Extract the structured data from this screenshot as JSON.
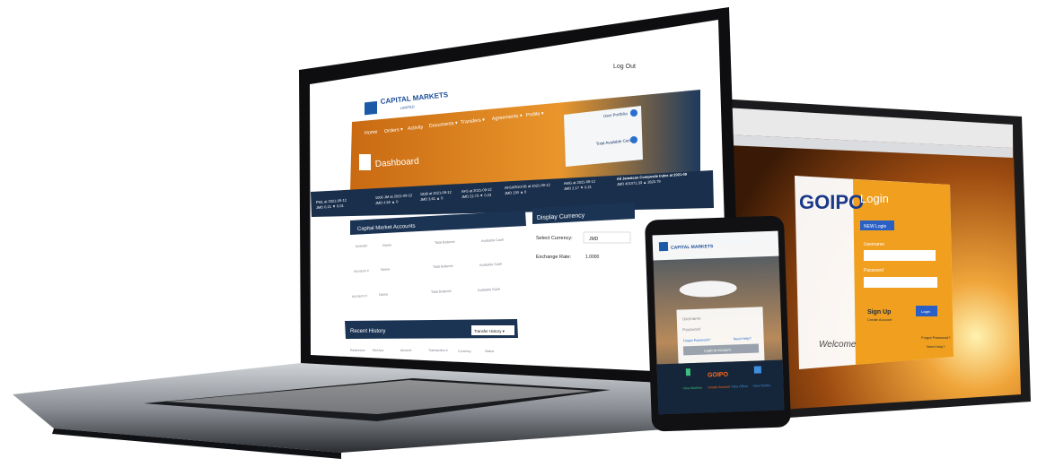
{
  "laptop": {
    "logout": "Log Out",
    "logo_title": "CAPITAL MARKETS",
    "logo_sub": "LIMITED",
    "nav": [
      "Home",
      "Orders ▾",
      "Activity",
      "Documents ▾",
      "Transfers ▾",
      "Agreements ▾",
      "Profile ▾"
    ],
    "user_card_1": "User Portfolio",
    "user_card_2": "Total Available Cash",
    "dashboard_title": "Dashboard",
    "tickers": [
      {
        "name": "PML at 2021-09-12",
        "val": "JMD 0.21 ▼ 0.01"
      },
      {
        "name": "1000 JM at 2021-09-12",
        "val": "JMD 4.50 ▲ 0"
      },
      {
        "name": "1838 at 2021-09-12",
        "val": "JMD 3.61 ▲ 0"
      },
      {
        "name": "AFS at 2021-09-12",
        "val": "JMD 22.73 ▼ 0.23"
      },
      {
        "name": "AFSXRGOVB at 2021-09-12",
        "val": "JMD 130 ▲ 0"
      },
      {
        "name": "AMG at 2021-09-12",
        "val": "JMD 2.17 ▼ 0.21"
      },
      {
        "name": "All Jamaican Composite Index at 2021-09",
        "val": "JMD 401071.33 ▲ 2820.79"
      }
    ],
    "accounts_title": "Capital Market Accounts",
    "accounts_rows": [
      [
        "Investor",
        "Name",
        "Total Balance",
        "Available Cash"
      ],
      [
        "Account #",
        "Name",
        "Total Balance",
        "Available Cash"
      ],
      [
        "Account #",
        "Name",
        "Total Balance",
        "Available Cash"
      ]
    ],
    "currency_title": "Display Currency",
    "select_currency_label": "Select Currency:",
    "select_currency_value": "JMD",
    "exchange_rate_label": "Exchange Rate:",
    "exchange_rate_value": "1.0000",
    "history_title": "Recent History",
    "history_select": "Transfer History ▾",
    "history_cols": [
      "Reference",
      "Ref Acc",
      "Amount",
      "Transaction #",
      "Currency",
      "Status"
    ]
  },
  "tablet": {
    "logo": "GOIPO",
    "login_title": "Login",
    "tab_active": "NEW Login",
    "username_label": "Username",
    "password_label": "Password",
    "signup": "Sign Up",
    "signup_sub": "Create Account",
    "login_button": "Login",
    "welcome": "Welcome",
    "forgot": "Forgot Password?",
    "help": "Need help?"
  },
  "phone": {
    "logo": "CAPITAL MARKETS",
    "username_placeholder": "Username",
    "password_placeholder": "Password",
    "forgot_link": "Forgot Password?",
    "help_link": "Need Help?",
    "login_button": "Login to Account",
    "brand": "GOIPO",
    "bottom_items": [
      "View Markets",
      "Create Account",
      "View Offers",
      "View Stocks"
    ]
  },
  "colors": {
    "navy": "#1c3454",
    "orange": "#e8891f",
    "dark_orange": "#a8570c",
    "gold": "#f0b43a"
  }
}
